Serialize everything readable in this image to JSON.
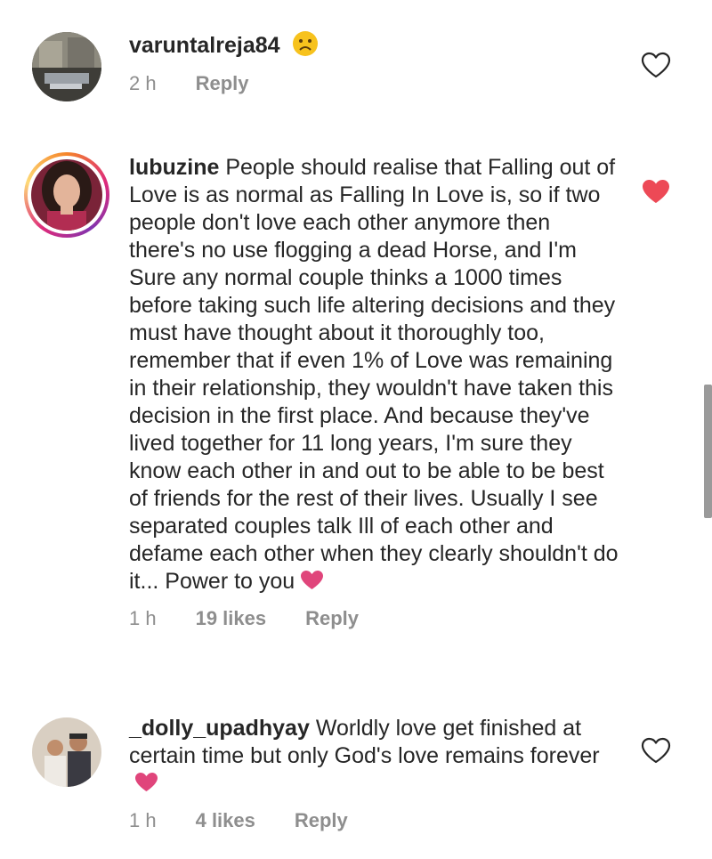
{
  "comments": [
    {
      "username": "varuntalreja84",
      "text": "",
      "emoji_icon": "sad-face-emoji",
      "time": "2 h",
      "likes": "",
      "reply_label": "Reply",
      "liked": false
    },
    {
      "username": "lubuzine",
      "text": "People should realise that Falling out of Love is as normal as Falling In Love is, so if two people don't love each other anymore then there's no use flogging a dead Horse, and I'm Sure any normal couple thinks a 1000 times before taking such life altering decisions and they must have thought about it thoroughly too, remember that if even 1% of Love was remaining in their relationship, they wouldn't have taken this decision in the first place. And because they've lived together for 11 long years, I'm sure they know each other in and out to be able to be best of friends for the rest of their lives. Usually I see separated couples talk Ill of each other and defame each other when they clearly shouldn't do it... Power to you",
      "time": "1 h",
      "likes": "19 likes",
      "reply_label": "Reply",
      "liked": true
    },
    {
      "username": "_dolly_upadhyay",
      "text": "Worldly love get finished at certain time but only God's love remains forever",
      "time": "1 h",
      "likes": "4 likes",
      "reply_label": "Reply",
      "liked": false
    }
  ],
  "colors": {
    "like_red": "#ed4956",
    "pink_heart": "#e0457b",
    "muted": "#8e8e8e",
    "text": "#262626"
  },
  "icons": {
    "like_outline": "heart-outline-icon",
    "like_filled": "heart-filled-icon",
    "inline_heart": "pink-heart-emoji"
  }
}
